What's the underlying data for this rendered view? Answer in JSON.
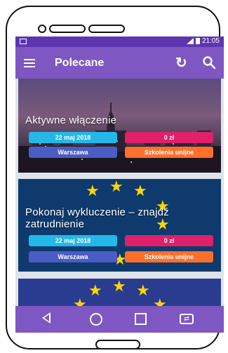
{
  "status_bar": {
    "time": "21:05"
  },
  "app_bar": {
    "title": "Polecane",
    "menu_icon": "menu-icon",
    "refresh_icon": "refresh-icon",
    "search_icon": "search-icon"
  },
  "cards": [
    {
      "title": "Aktywne włączenie",
      "date": "22 maj 2018",
      "price": "0 zł",
      "city": "Warszawa",
      "category": "Szkolenia unijne",
      "image": "warsaw-skyline"
    },
    {
      "title": "Pokonaj wykluczenie – znajdź zatrudnienie",
      "date": "22 maj 2018",
      "price": "0 zł",
      "city": "Warszawa",
      "category": "Szkolenia unijne",
      "image": "eu-flag"
    },
    {
      "image": "eu-flag"
    }
  ],
  "nav_bar": {
    "back_icon": "back-icon",
    "home_icon": "home-icon",
    "recent_icon": "recent-apps-icon",
    "extra_icon": "screen-cast-icon"
  },
  "colors": {
    "app_bar": "#7e57c2",
    "status_bar": "#5e35b1",
    "chip_date": "#24b8e8",
    "chip_price": "#e0206a",
    "chip_city": "#4b5cc4",
    "chip_category": "#ff6f2c",
    "eu_star": "#ffd600"
  }
}
